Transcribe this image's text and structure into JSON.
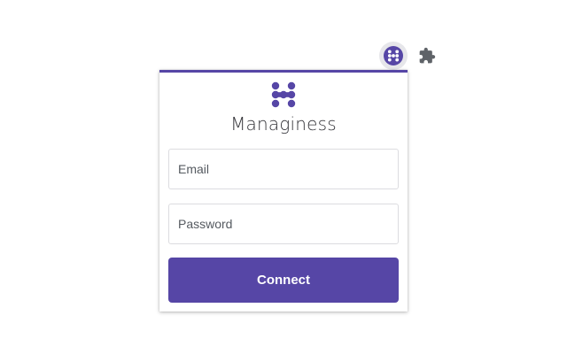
{
  "extension_bar": {
    "items": [
      {
        "icon": "managiness-icon",
        "active": true
      },
      {
        "icon": "puzzle-icon",
        "active": false
      }
    ]
  },
  "popup": {
    "brand_name": "Managiness",
    "logo_icon": "managiness-logo-icon",
    "email": {
      "placeholder": "Email",
      "value": ""
    },
    "password": {
      "placeholder": "Password",
      "value": ""
    },
    "connect_label": "Connect"
  },
  "colors": {
    "accent": "#5646a6",
    "field_border": "#dcdce0",
    "text": "#333338",
    "active_ext_bg": "#e6e6ea"
  }
}
